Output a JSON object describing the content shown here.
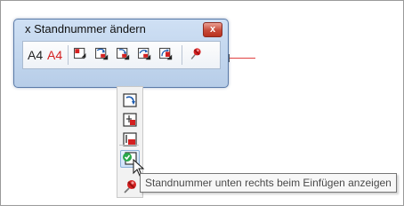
{
  "window": {
    "title": "x Standnummer ändern",
    "close_label": "x"
  },
  "toolbar": {
    "a4_black": "A4",
    "a4_red": "A4",
    "buttons": [
      {
        "name": "position-top-left-button",
        "icon": "number-top-left-icon"
      },
      {
        "name": "position-top-right-button",
        "icon": "number-top-right-icon"
      },
      {
        "name": "position-bottom-right-button",
        "icon": "number-bottom-right-icon"
      },
      {
        "name": "position-bottom-left-button",
        "icon": "number-bottom-left-icon"
      },
      {
        "name": "position-right-button",
        "icon": "number-right-icon"
      },
      {
        "name": "pin-button",
        "icon": "pushpin-icon"
      }
    ]
  },
  "dropdown": {
    "items": [
      {
        "name": "rotate-number-item",
        "icon": "rotate-arrow-icon"
      },
      {
        "name": "position-center-right-item",
        "icon": "number-center-right-icon"
      },
      {
        "name": "position-bottom-left-item",
        "icon": "number-bottom-left-icon"
      },
      {
        "name": "position-bottom-right-item",
        "icon": "number-bottom-right-icon"
      },
      {
        "name": "show-bottom-right-on-insert-item",
        "icon": "checkmark-icon",
        "checked": true
      },
      {
        "name": "pin-item",
        "icon": "pushpin-icon"
      }
    ]
  },
  "tooltip": {
    "text": "Standnummer unten rechts beim Einfügen anzeigen"
  },
  "colors": {
    "accent_red": "#d42020",
    "title_bar": "#c6d9f1",
    "check_green": "#2aa84a"
  }
}
